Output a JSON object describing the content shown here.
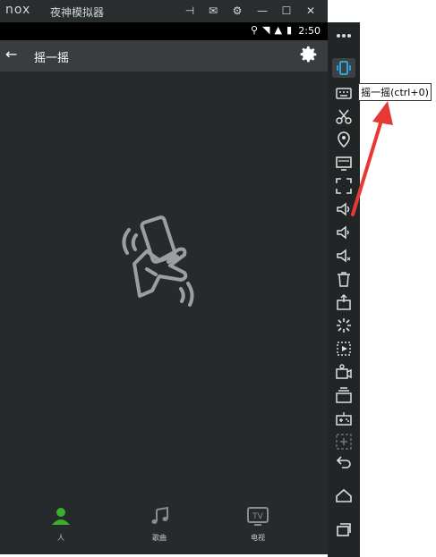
{
  "window": {
    "logo": "nox",
    "title": "夜神模拟器"
  },
  "statusbar": {
    "time": "2:50"
  },
  "header": {
    "title": "摇一摇"
  },
  "tabs": [
    {
      "label": "人",
      "icon": "person-icon",
      "color": "#39b027"
    },
    {
      "label": "歌曲",
      "icon": "music-icon",
      "color": "#8a8d8f"
    },
    {
      "label": "电视",
      "icon": "tv-icon",
      "color": "#8a8d8f"
    }
  ],
  "sidebar": {
    "tooltip": "摇一摇(ctrl+0)",
    "items": [
      "more-icon",
      "shake-icon",
      "keyboard-icon",
      "scissors-icon",
      "location-icon",
      "screen-icon",
      "fullscreen-icon",
      "volume-up-icon",
      "volume-down-icon",
      "mute-icon",
      "trash-icon",
      "apk-icon",
      "loading-icon",
      "macro-icon",
      "camera-icon",
      "multi-window-icon",
      "gamepad-icon",
      "add-icon",
      "back-icon",
      "home-icon",
      "recent-apps-icon"
    ]
  },
  "colors": {
    "accent": "#39b027",
    "arrow": "#e53935",
    "active_icon": "#2ab4e8"
  }
}
